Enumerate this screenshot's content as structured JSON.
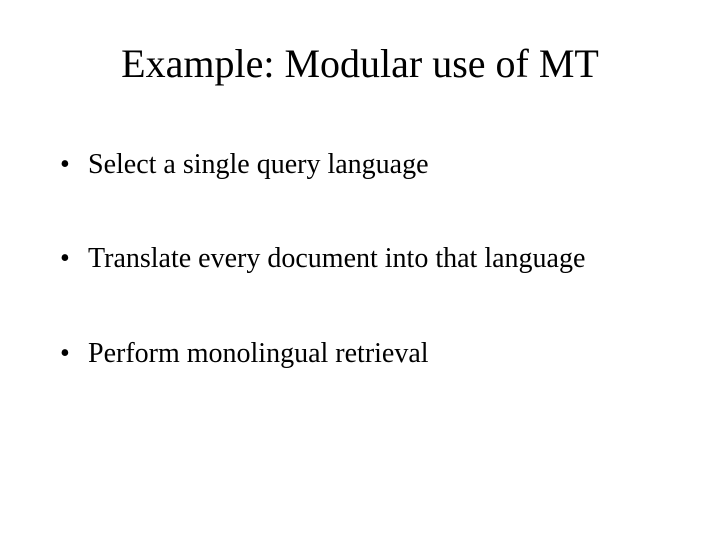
{
  "title": "Example: Modular use of MT",
  "bullets": [
    "Select a single query language",
    "Translate every document into that language",
    "Perform monolingual retrieval"
  ]
}
